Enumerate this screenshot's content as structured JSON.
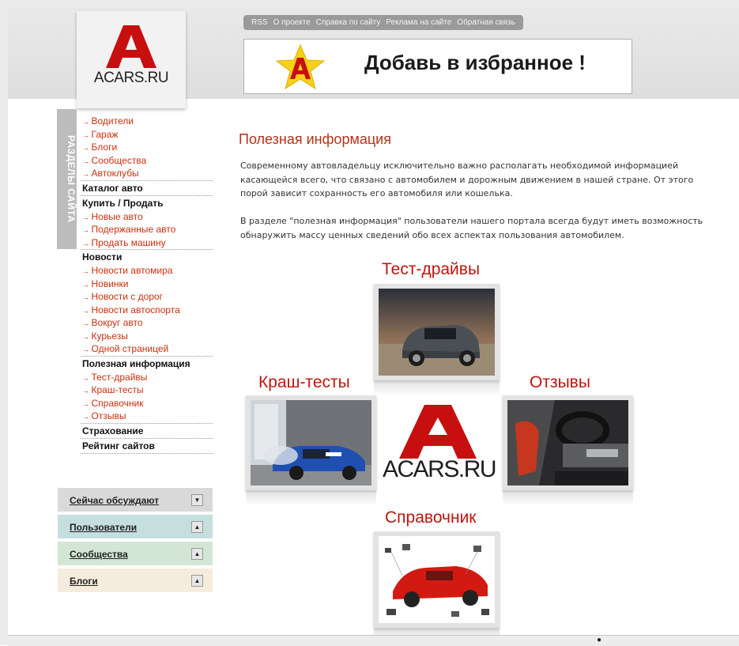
{
  "site": {
    "logo_letter": "A",
    "logo_text": "ACARS.RU"
  },
  "top_links": [
    "RSS",
    "О проекте",
    "Справка по сайту",
    "Реклама на сайте",
    "Обратная связь"
  ],
  "banner": {
    "text": "Добавь в избранное !",
    "icon": "star-icon"
  },
  "side_tab": "РАЗДЕЛЫ САЙТА",
  "nav": {
    "top_items": [
      "Водители",
      "Гараж",
      "Блоги",
      "Сообщества",
      "Автоклубы"
    ],
    "catalog": "Каталог авто",
    "buy_sell": "Купить / Продать",
    "buy_sell_items": [
      "Новые авто",
      "Подержанные авто",
      "Продать машину"
    ],
    "news": "Новости",
    "news_items": [
      "Новости автомира",
      "Новинки",
      "Новости с дорог",
      "Новости автоспорта",
      "Вокруг авто",
      "Курьезы",
      "Одной страницей"
    ],
    "useful": "Полезная информация",
    "useful_items": [
      "Тест-драйвы",
      "Краш-тесты",
      "Справочник",
      "Отзывы"
    ],
    "insurance": "Страхование",
    "rating": "Рейтинг сайтов"
  },
  "accordion": [
    {
      "label": "Сейчас обсуждают",
      "color": "#d9d9d9",
      "arrow": "▼"
    },
    {
      "label": "Пользователи",
      "color": "#c5dede",
      "arrow": "▲"
    },
    {
      "label": "Сообщества",
      "color": "#d3e6d3",
      "arrow": "▲"
    },
    {
      "label": "Блоги",
      "color": "#f6ecdd",
      "arrow": "▲"
    }
  ],
  "main": {
    "title": "Полезная информация",
    "para1": "Современному автовладельцу исключительно важно располагать необходимой информацией касающейся всего, что связано с автомобилем и дорожным движением в нашей стране. От этого порой зависит сохранность его автомобиля или кошелька.",
    "para2": "В разделе \"полезная информация\" пользователи нашего портала всегда будут иметь возможность обнаружить массу ценных сведений обо всех аспектах пользования автомобилем."
  },
  "categories": {
    "test_drives": "Тест-драйвы",
    "crash_tests": "Краш-тесты",
    "reviews": "Отзывы",
    "reference": "Справочник"
  },
  "center_logo_text": "ACARS.RU",
  "colors": {
    "accent_red": "#c0140f",
    "link_red": "#c8300e"
  }
}
